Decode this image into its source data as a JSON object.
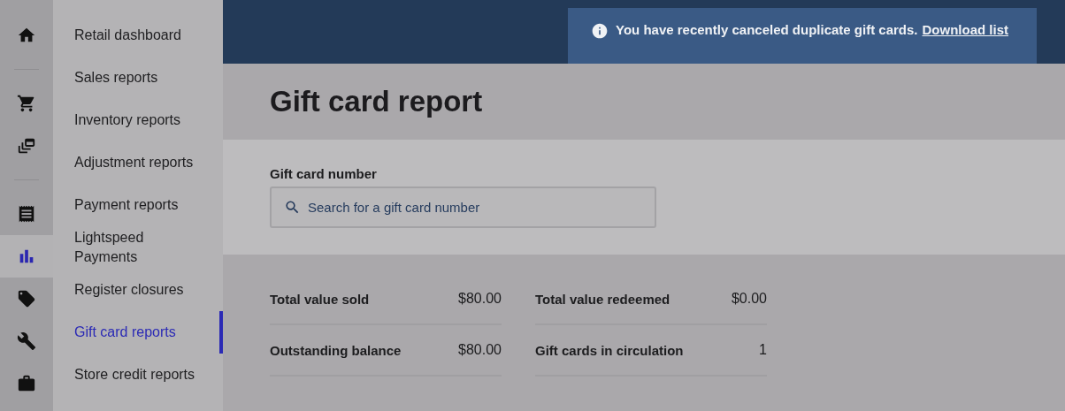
{
  "rail": {
    "groups": [
      [
        {
          "selected": false
        }
      ],
      [
        {
          "selected": false
        },
        {
          "selected": false
        }
      ],
      [
        {
          "selected": false
        },
        {
          "selected": true
        },
        {
          "selected": false
        },
        {
          "selected": false
        },
        {
          "selected": false
        }
      ]
    ]
  },
  "nav": {
    "items": [
      {
        "label": "Retail dashboard",
        "selected": false
      },
      {
        "label": "Sales reports",
        "selected": false
      },
      {
        "label": "Inventory reports",
        "selected": false
      },
      {
        "label": "Adjustment reports",
        "selected": false
      },
      {
        "label": "Payment reports",
        "selected": false
      },
      {
        "label": "Lightspeed Payments",
        "selected": false
      },
      {
        "label": "Register closures",
        "selected": false
      },
      {
        "label": "Gift card reports",
        "selected": true
      },
      {
        "label": "Store credit reports",
        "selected": false
      }
    ]
  },
  "notice": {
    "message": "You have recently canceled duplicate gift cards.",
    "link": "Download list"
  },
  "page": {
    "title": "Gift card report"
  },
  "search": {
    "label": "Gift card number",
    "placeholder": "Search for a gift card number"
  },
  "stats": {
    "columns": [
      [
        {
          "label": "Total value sold",
          "value": "$80.00"
        },
        {
          "label": "Outstanding balance",
          "value": "$80.00"
        }
      ],
      [
        {
          "label": "Total value redeemed",
          "value": "$0.00"
        },
        {
          "label": "Gift cards in circulation",
          "value": "1"
        }
      ]
    ]
  }
}
